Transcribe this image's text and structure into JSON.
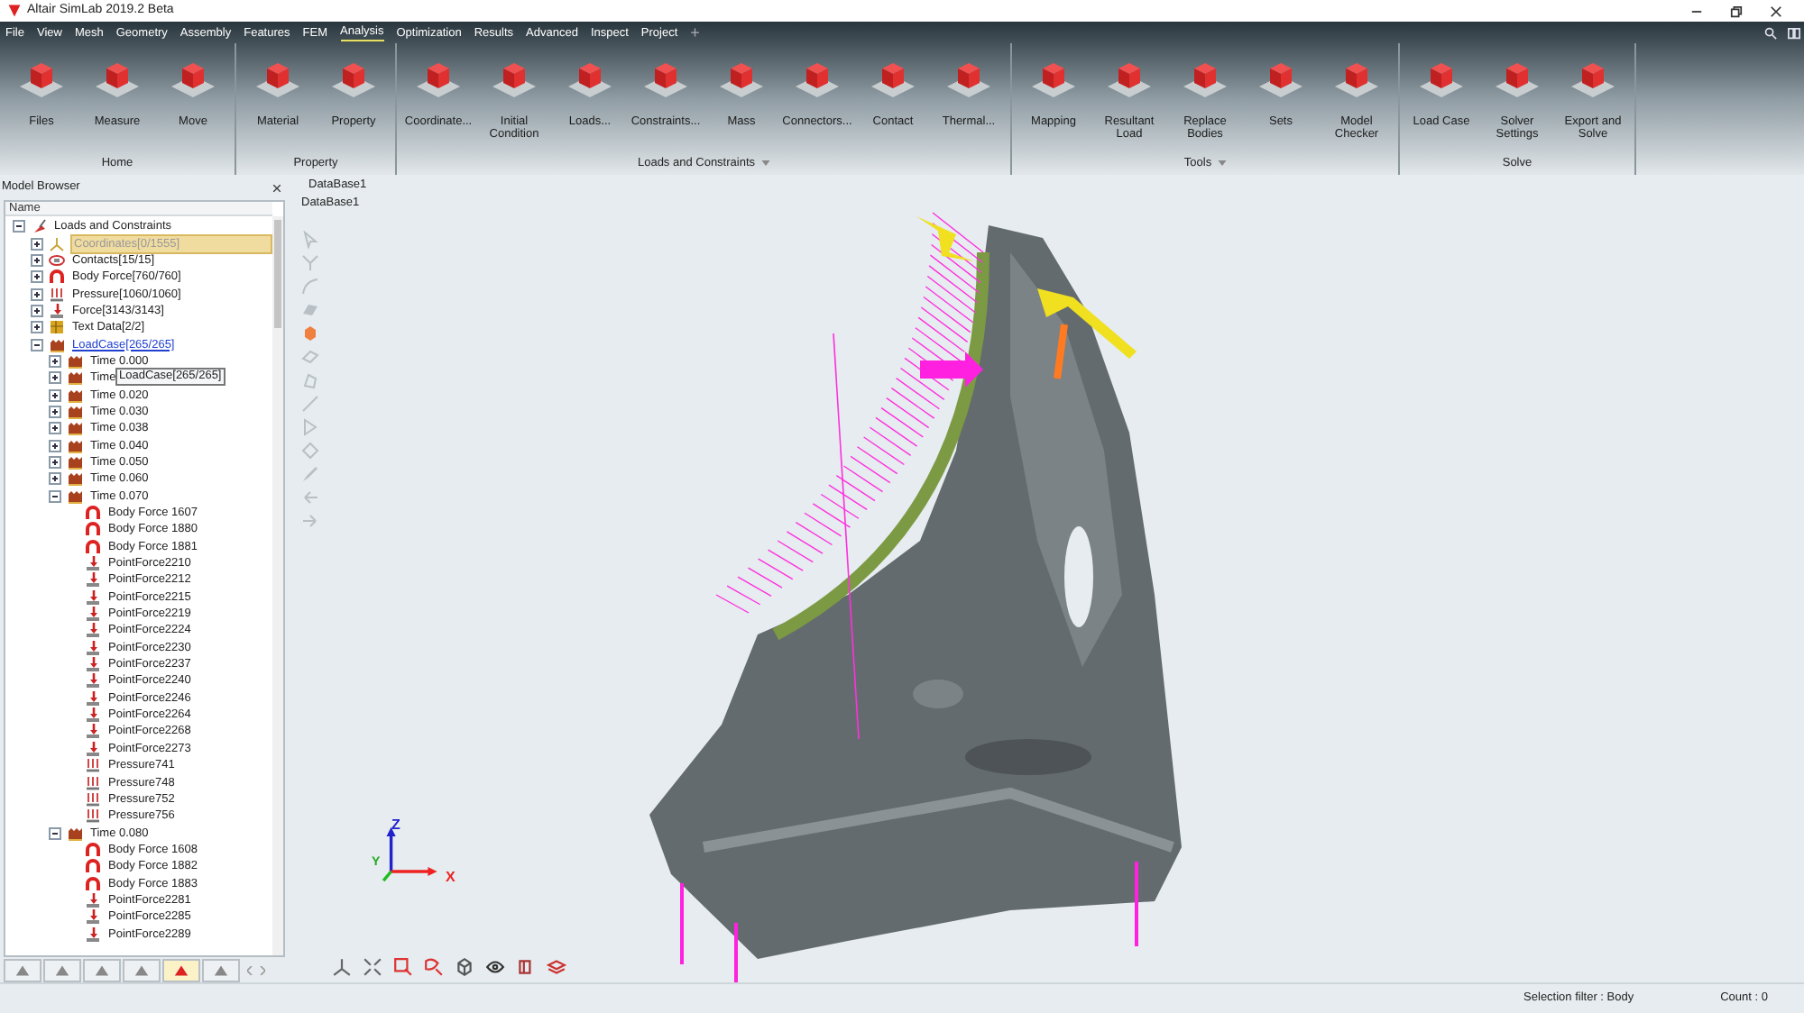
{
  "window": {
    "title": "Altair SimLab 2019.2 Beta"
  },
  "menu": [
    {
      "label": "File",
      "selected": false
    },
    {
      "label": "View",
      "selected": false
    },
    {
      "label": "Mesh",
      "selected": false
    },
    {
      "label": "Geometry",
      "selected": false
    },
    {
      "label": "Assembly",
      "selected": false
    },
    {
      "label": "Features",
      "selected": false
    },
    {
      "label": "FEM",
      "selected": false
    },
    {
      "label": "Analysis",
      "selected": true
    },
    {
      "label": "Optimization",
      "selected": false
    },
    {
      "label": "Results",
      "selected": false
    },
    {
      "label": "Advanced",
      "selected": false
    },
    {
      "label": "Inspect",
      "selected": false
    },
    {
      "label": "Project",
      "selected": false
    }
  ],
  "menu_add": "+",
  "ribbon": [
    {
      "label": "Home",
      "dropdown": false,
      "buttons": [
        "Files",
        "Measure",
        "Move"
      ]
    },
    {
      "label": "Property",
      "dropdown": false,
      "buttons": [
        "Material",
        "Property"
      ]
    },
    {
      "label": "Loads and Constraints",
      "dropdown": true,
      "buttons": [
        "Coordinate...",
        "Initial Condition",
        "Loads...",
        "Constraints...",
        "Mass",
        "Connectors...",
        "Contact",
        "Thermal..."
      ]
    },
    {
      "label": "Tools",
      "dropdown": true,
      "buttons": [
        "Mapping",
        "Resultant Load",
        "Replace Bodies",
        "Sets",
        "Model Checker"
      ]
    },
    {
      "label": "Solve",
      "dropdown": false,
      "buttons": [
        "Load Case",
        "Solver Settings",
        "Export and Solve"
      ]
    }
  ],
  "model_browser": {
    "title": "Model Browser",
    "column": "Name",
    "tooltip": "LoadCase[265/265]",
    "tree": [
      {
        "label": "Loads and Constraints",
        "kind": "root",
        "expanded": true,
        "selected": false,
        "hovered": false,
        "children": [
          {
            "label": "Coordinates[0/1555]",
            "kind": "coordinates",
            "expanded": false,
            "selected": true,
            "hovered": false
          },
          {
            "label": "Contacts[15/15]",
            "kind": "contact",
            "expanded": false,
            "selected": false,
            "hovered": false
          },
          {
            "label": "Body Force[760/760]",
            "kind": "body_force",
            "expanded": false,
            "selected": false,
            "hovered": false
          },
          {
            "label": "Pressure[1060/1060]",
            "kind": "pressure",
            "expanded": false,
            "selected": false,
            "hovered": false
          },
          {
            "label": "Force[3143/3143]",
            "kind": "force",
            "expanded": false,
            "selected": false,
            "hovered": false
          },
          {
            "label": "Text Data[2/2]",
            "kind": "text_data",
            "expanded": false,
            "selected": false,
            "hovered": false
          },
          {
            "label": "LoadCase[265/265]",
            "kind": "loadcase",
            "expanded": true,
            "selected": false,
            "hovered": true,
            "children": [
              {
                "label": "Time 0.000",
                "kind": "loadcase",
                "expanded": false,
                "selected": false,
                "hovered": false
              },
              {
                "label": "Time",
                "kind": "loadcase",
                "expanded": false,
                "selected": false,
                "hovered": false
              },
              {
                "label": "Time 0.020",
                "kind": "loadcase",
                "expanded": false,
                "selected": false,
                "hovered": false
              },
              {
                "label": "Time 0.030",
                "kind": "loadcase",
                "expanded": false,
                "selected": false,
                "hovered": false
              },
              {
                "label": "Time 0.038",
                "kind": "loadcase",
                "expanded": false,
                "selected": false,
                "hovered": false
              },
              {
                "label": "Time 0.040",
                "kind": "loadcase",
                "expanded": false,
                "selected": false,
                "hovered": false
              },
              {
                "label": "Time 0.050",
                "kind": "loadcase",
                "expanded": false,
                "selected": false,
                "hovered": false
              },
              {
                "label": "Time 0.060",
                "kind": "loadcase",
                "expanded": false,
                "selected": false,
                "hovered": false
              },
              {
                "label": "Time 0.070",
                "kind": "loadcase",
                "expanded": true,
                "selected": false,
                "hovered": false,
                "children": [
                  {
                    "label": "Body Force 1607",
                    "kind": "body_force",
                    "selected": false,
                    "hovered": false
                  },
                  {
                    "label": "Body Force 1880",
                    "kind": "body_force",
                    "selected": false,
                    "hovered": false
                  },
                  {
                    "label": "Body Force 1881",
                    "kind": "body_force",
                    "selected": false,
                    "hovered": false
                  },
                  {
                    "label": "PointForce2210",
                    "kind": "force",
                    "selected": false,
                    "hovered": false
                  },
                  {
                    "label": "PointForce2212",
                    "kind": "force",
                    "selected": false,
                    "hovered": false
                  },
                  {
                    "label": "PointForce2215",
                    "kind": "force",
                    "selected": false,
                    "hovered": false
                  },
                  {
                    "label": "PointForce2219",
                    "kind": "force",
                    "selected": false,
                    "hovered": false
                  },
                  {
                    "label": "PointForce2224",
                    "kind": "force",
                    "selected": false,
                    "hovered": false
                  },
                  {
                    "label": "PointForce2230",
                    "kind": "force",
                    "selected": false,
                    "hovered": false
                  },
                  {
                    "label": "PointForce2237",
                    "kind": "force",
                    "selected": false,
                    "hovered": false
                  },
                  {
                    "label": "PointForce2240",
                    "kind": "force",
                    "selected": false,
                    "hovered": false
                  },
                  {
                    "label": "PointForce2246",
                    "kind": "force",
                    "selected": false,
                    "hovered": false
                  },
                  {
                    "label": "PointForce2264",
                    "kind": "force",
                    "selected": false,
                    "hovered": false
                  },
                  {
                    "label": "PointForce2268",
                    "kind": "force",
                    "selected": false,
                    "hovered": false
                  },
                  {
                    "label": "PointForce2273",
                    "kind": "force",
                    "selected": false,
                    "hovered": false
                  },
                  {
                    "label": "Pressure741",
                    "kind": "pressure",
                    "selected": false,
                    "hovered": false
                  },
                  {
                    "label": "Pressure748",
                    "kind": "pressure",
                    "selected": false,
                    "hovered": false
                  },
                  {
                    "label": "Pressure752",
                    "kind": "pressure",
                    "selected": false,
                    "hovered": false
                  },
                  {
                    "label": "Pressure756",
                    "kind": "pressure",
                    "selected": false,
                    "hovered": false
                  }
                ]
              },
              {
                "label": "Time 0.080",
                "kind": "loadcase",
                "expanded": true,
                "selected": false,
                "hovered": false,
                "children": [
                  {
                    "label": "Body Force 1608",
                    "kind": "body_force",
                    "selected": false,
                    "hovered": false
                  },
                  {
                    "label": "Body Force 1882",
                    "kind": "body_force",
                    "selected": false,
                    "hovered": false
                  },
                  {
                    "label": "Body Force 1883",
                    "kind": "body_force",
                    "selected": false,
                    "hovered": false
                  },
                  {
                    "label": "PointForce2281",
                    "kind": "force",
                    "selected": false,
                    "hovered": false
                  },
                  {
                    "label": "PointForce2285",
                    "kind": "force",
                    "selected": false,
                    "hovered": false
                  },
                  {
                    "label": "PointForce2289",
                    "kind": "force",
                    "selected": false,
                    "hovered": false
                  }
                ]
              }
            ]
          }
        ]
      }
    ],
    "tabs": [
      {
        "selected": false
      },
      {
        "selected": false
      },
      {
        "selected": false
      },
      {
        "selected": false
      },
      {
        "selected": true
      },
      {
        "selected": false
      }
    ]
  },
  "viewport": {
    "tab": "DataBase1",
    "title": "DataBase1",
    "axes": {
      "z": "Z",
      "y": "Y",
      "x": "X"
    }
  },
  "status_bar": {
    "selection_filter": "Selection filter : Body",
    "count": "Count : 0"
  }
}
